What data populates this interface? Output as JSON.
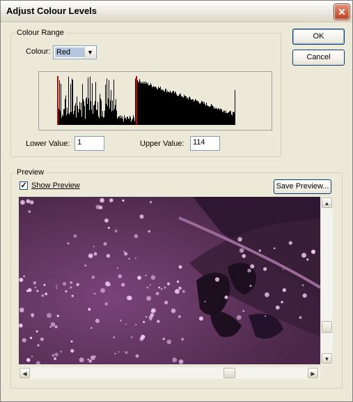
{
  "window": {
    "title": "Adjust Colour Levels",
    "close_label": "✕"
  },
  "buttons": {
    "ok": "OK",
    "cancel": "Cancel"
  },
  "colour_range": {
    "group_label": "Colour Range",
    "colour_label": "Colour:",
    "colour_value": "Red",
    "lower_label": "Lower Value:",
    "lower_value": "1",
    "upper_label": "Upper Value:",
    "upper_value": "114"
  },
  "histogram": {
    "lower_marker": 1,
    "upper_marker": 114,
    "marker_color": "#cc0000"
  },
  "preview": {
    "group_label": "Preview",
    "show_preview_label": "Show Preview",
    "show_preview_checked": true,
    "save_preview_label": "Save Preview...",
    "tint_color": "#a65aa6"
  },
  "icons": {
    "close": "close-icon",
    "dropdown": "chevron-down-icon",
    "scroll_up": "chevron-up-icon",
    "scroll_down": "chevron-down-icon",
    "scroll_left": "chevron-left-icon",
    "scroll_right": "chevron-right-icon"
  }
}
